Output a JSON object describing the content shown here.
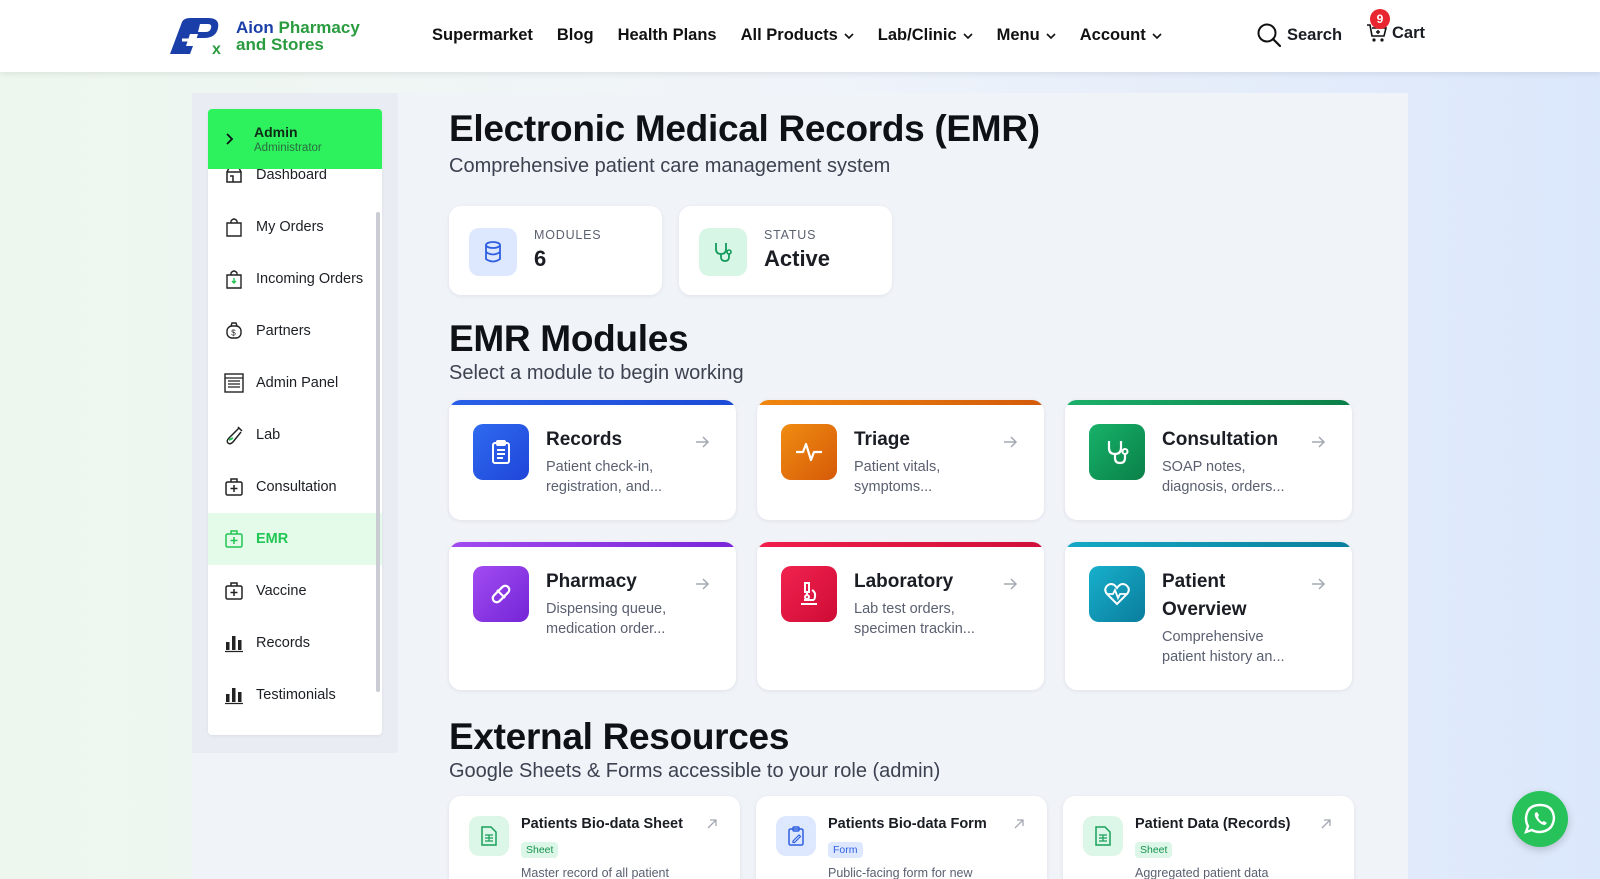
{
  "brand": {
    "line1_a": "Aion",
    "line1_b": "Pharmacy",
    "line2": "and Stores"
  },
  "nav": {
    "items": [
      {
        "label": "Supermarket"
      },
      {
        "label": "Blog"
      },
      {
        "label": "Health Plans"
      },
      {
        "label": "All Products"
      },
      {
        "label": "Lab/Clinic"
      },
      {
        "label": "Menu"
      },
      {
        "label": "Account"
      }
    ],
    "search_label": "Search",
    "cart_label": "Cart",
    "cart_count": "9"
  },
  "sidebar": {
    "user_name": "Admin",
    "user_role": "Administrator",
    "items": [
      {
        "label": "Dashboard",
        "icon": "store-icon"
      },
      {
        "label": "My Orders",
        "icon": "bag-icon"
      },
      {
        "label": "Incoming Orders",
        "icon": "incoming-bag-icon"
      },
      {
        "label": "Partners",
        "icon": "partners-icon"
      },
      {
        "label": "Admin Panel",
        "icon": "admin-panel-icon"
      },
      {
        "label": "Lab",
        "icon": "test-tube-icon"
      },
      {
        "label": "Consultation",
        "icon": "medical-kit-icon"
      },
      {
        "label": "EMR",
        "icon": "emr-kit-icon",
        "active": true
      },
      {
        "label": "Vaccine",
        "icon": "vaccine-kit-icon"
      },
      {
        "label": "Records",
        "icon": "bar-chart-icon"
      },
      {
        "label": "Testimonials",
        "icon": "bar-chart-icon"
      }
    ]
  },
  "page": {
    "title": "Electronic Medical Records (EMR)",
    "subtitle": "Comprehensive patient care management system"
  },
  "stats": {
    "modules_label": "MODULES",
    "modules_value": "6",
    "status_label": "STATUS",
    "status_value": "Active"
  },
  "modules_section": {
    "title": "EMR Modules",
    "subtitle": "Select a module to begin working",
    "items": [
      {
        "title": "Records",
        "desc1": "Patient check-in,",
        "desc2": "registration, and...",
        "color": "#1d4fe0"
      },
      {
        "title": "Triage",
        "desc1": "Patient vitals,",
        "desc2": "symptoms...",
        "color": "#e36a0a"
      },
      {
        "title": "Consultation",
        "desc1": "SOAP notes,",
        "desc2": "diagnosis, orders...",
        "color": "#119a5a"
      },
      {
        "title": "Pharmacy",
        "desc1": "Dispensing queue,",
        "desc2": "medication order...",
        "color": "#8b2fe0"
      },
      {
        "title": "Laboratory",
        "desc1": "Lab test orders,",
        "desc2": "specimen trackin...",
        "color": "#e0143e"
      },
      {
        "title": "Patient Overview",
        "title1": "Patient",
        "title2": "Overview",
        "desc1": "Comprehensive",
        "desc2": "patient history an...",
        "color": "#0a93b5"
      }
    ]
  },
  "resources_section": {
    "title": "External Resources",
    "subtitle": "Google Sheets & Forms accessible to your role (admin)",
    "items": [
      {
        "title": "Patients Bio-data Sheet",
        "tag": "Sheet",
        "desc": "Master record of all patient"
      },
      {
        "title": "Patients Bio-data Form",
        "tag": "Form",
        "desc": "Public-facing form for new"
      },
      {
        "title": "Patient Data (Records)",
        "tag": "Sheet",
        "desc": "Aggregated patient data"
      }
    ]
  }
}
